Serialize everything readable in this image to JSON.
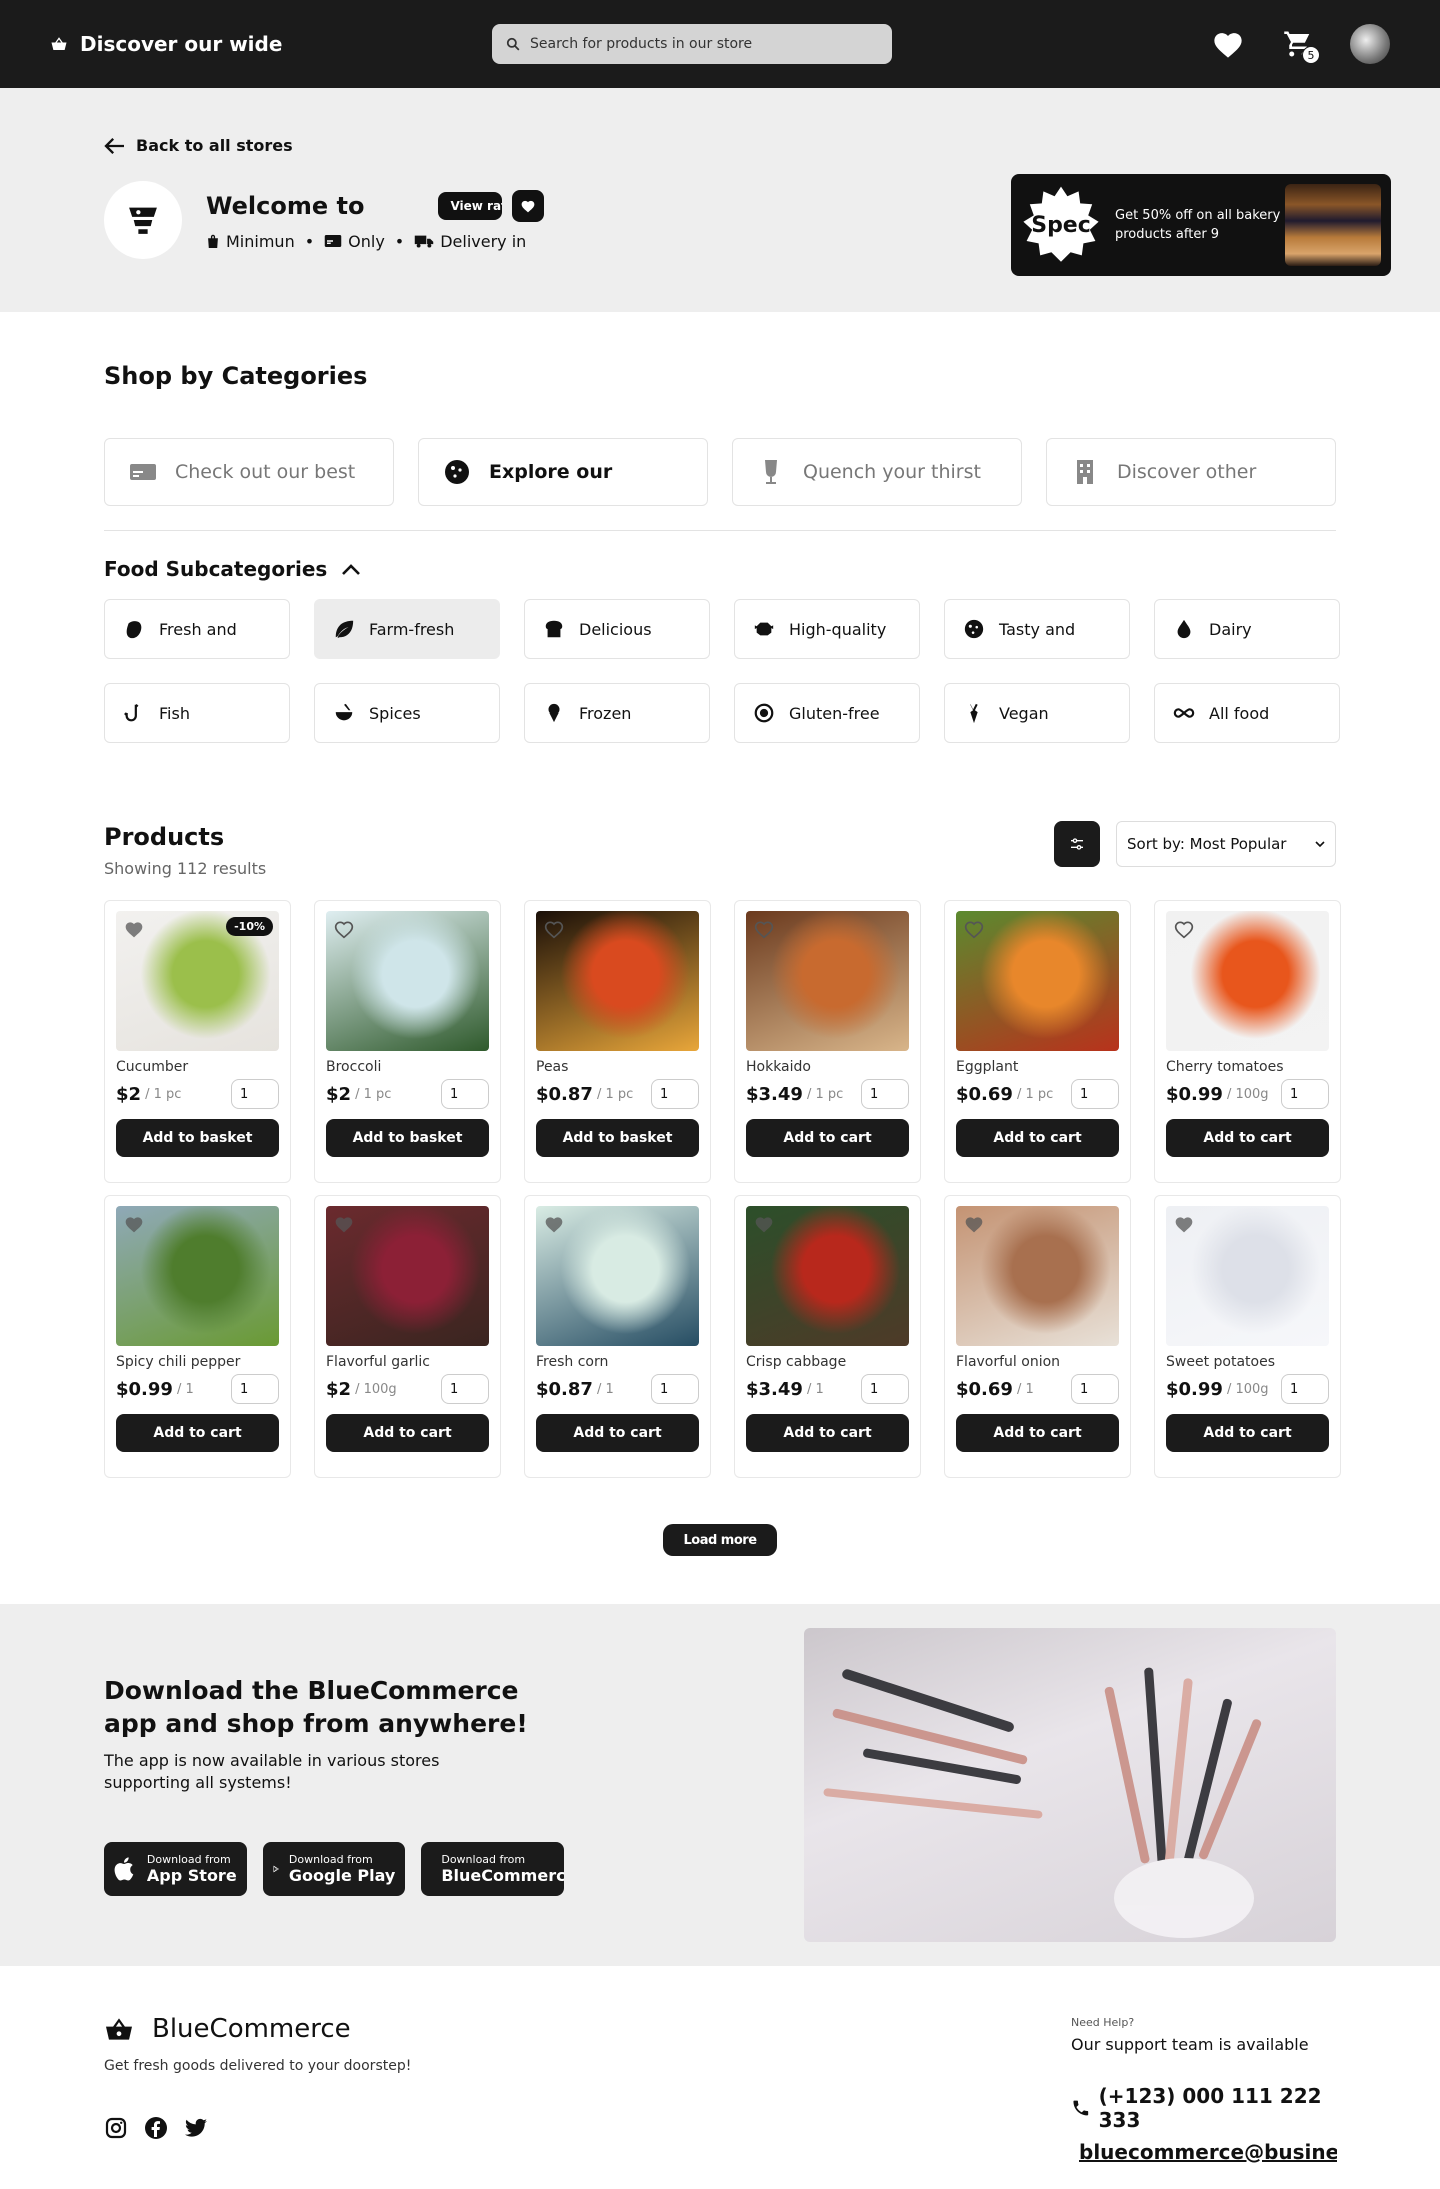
{
  "header": {
    "brand": "Discover our wide",
    "search_placeholder": "Search for products in our store",
    "cart_count": "5"
  },
  "store": {
    "back_label": "Back to all stores",
    "welcome": "Welcome to",
    "view_ratings": "View ratings",
    "meta": {
      "minimum": "Minimun",
      "only": "Only",
      "delivery": "Delivery in"
    },
    "promo": {
      "badge": "Spec",
      "text": "Get 50% off on all bakery products after 9"
    }
  },
  "categories": {
    "title": "Shop by Categories",
    "items": [
      {
        "label": "Check out our best",
        "icon": "card-icon"
      },
      {
        "label": "Explore our",
        "icon": "cookie-icon"
      },
      {
        "label": "Quench your thirst",
        "icon": "drink-icon"
      },
      {
        "label": "Discover other",
        "icon": "building-icon"
      }
    ]
  },
  "subcategories": {
    "title": "Food Subcategories",
    "items": [
      {
        "label": "Fresh and",
        "icon": "apple-icon"
      },
      {
        "label": "Farm-fresh",
        "icon": "leaf-icon"
      },
      {
        "label": "Delicious",
        "icon": "bread-icon"
      },
      {
        "label": "High-quality",
        "icon": "meat-icon"
      },
      {
        "label": "Tasty and",
        "icon": "cookie-icon"
      },
      {
        "label": "Dairy",
        "icon": "drop-icon"
      },
      {
        "label": "Fish",
        "icon": "fishhook-icon"
      },
      {
        "label": "Spices",
        "icon": "mortar-icon"
      },
      {
        "label": "Frozen",
        "icon": "icecream-icon"
      },
      {
        "label": "Gluten-free",
        "icon": "no-wheat-icon"
      },
      {
        "label": "Vegan",
        "icon": "carrot-icon"
      },
      {
        "label": "All food",
        "icon": "infinity-icon"
      }
    ]
  },
  "products": {
    "title": "Products",
    "count": "Showing 112 results",
    "sort_label": "Sort by: Most Popular",
    "load_more": "Load more",
    "items": [
      {
        "name": "Cucumber",
        "price": "$2",
        "unit": "/ 1 pc",
        "qty": "1",
        "button": "Add to basket",
        "badge": "-10%",
        "fav": true,
        "colors": [
          "#f2f1ef",
          "#9bbf4b",
          "#e6e3de"
        ]
      },
      {
        "name": "Broccoli",
        "price": "$2",
        "unit": "/ 1 pc",
        "qty": "1",
        "button": "Add to basket",
        "fav": false,
        "colors": [
          "#dfeef1",
          "#cfe5e9",
          "#2f5a2c"
        ]
      },
      {
        "name": "Peas",
        "price": "$0.87",
        "unit": "/ 1 pc",
        "qty": "1",
        "button": "Add to basket",
        "fav": false,
        "colors": [
          "#1a0f08",
          "#d94a1f",
          "#e8a63a"
        ]
      },
      {
        "name": "Hokkaido",
        "price": "$3.49",
        "unit": "/ 1 pc",
        "qty": "1",
        "button": "Add to cart",
        "fav": false,
        "colors": [
          "#6b3a1e",
          "#c86a2f",
          "#d8b58a"
        ]
      },
      {
        "name": "Eggplant",
        "price": "$0.69",
        "unit": "/ 1 pc",
        "qty": "1",
        "button": "Add to cart",
        "fav": false,
        "colors": [
          "#5b8a2f",
          "#e8872b",
          "#b8321c"
        ]
      },
      {
        "name": "Cherry tomatoes",
        "price": "$0.99",
        "unit": "/ 100g",
        "qty": "1",
        "button": "Add to cart",
        "fav": false,
        "colors": [
          "#f1f1f1",
          "#e8561c",
          "#f3f3f3"
        ]
      },
      {
        "name": "Spicy chili pepper",
        "price": "$0.99",
        "unit": "/ 1",
        "qty": "1",
        "button": "Add to cart",
        "fav": true,
        "colors": [
          "#8fa9b8",
          "#4f7d2d",
          "#6a9a33"
        ]
      },
      {
        "name": "Flavorful garlic",
        "price": "$2",
        "unit": "/ 100g",
        "qty": "1",
        "button": "Add to cart",
        "fav": true,
        "colors": [
          "#6b2a2e",
          "#8c2036",
          "#3a2520"
        ]
      },
      {
        "name": "Fresh corn",
        "price": "$0.87",
        "unit": "/ 1",
        "qty": "1",
        "button": "Add to cart",
        "fav": true,
        "colors": [
          "#d9ece4",
          "#d8ebe3",
          "#264d63"
        ]
      },
      {
        "name": "Crisp cabbage",
        "price": "$3.49",
        "unit": "/ 1",
        "qty": "1",
        "button": "Add to cart",
        "fav": true,
        "colors": [
          "#2c4f2a",
          "#b8281c",
          "#4e3a28"
        ]
      },
      {
        "name": "Flavorful onion",
        "price": "$0.69",
        "unit": "/ 1",
        "qty": "1",
        "button": "Add to cart",
        "fav": true,
        "colors": [
          "#c49373",
          "#a8704f",
          "#e8e1d8"
        ]
      },
      {
        "name": "Sweet potatoes",
        "price": "$0.99",
        "unit": "/ 100g",
        "qty": "1",
        "button": "Add to cart",
        "fav": true,
        "colors": [
          "#eef0f4",
          "#dde0e8",
          "#f6f7fa"
        ]
      }
    ]
  },
  "app": {
    "title": "Download the BlueCommerce app and shop from anywhere!",
    "text": "The app is now available in various stores supporting all systems!",
    "buttons": [
      {
        "small": "Download from",
        "large": "App Store",
        "icon": "apple-icon"
      },
      {
        "small": "Download from",
        "large": "Google Play",
        "icon": "play-icon"
      },
      {
        "small": "Download from",
        "large": "BlueCommerce",
        "icon": "bluecommerce-icon"
      }
    ]
  },
  "footer": {
    "brand": "BlueCommerce",
    "tagline": "Get fresh goods delivered to your doorstep!",
    "help_small": "Need Help?",
    "help_text": "Our support team is available",
    "phone": "(+123) 000 111 222 333",
    "email": "bluecommerce@business.com",
    "socials": [
      "instagram-icon",
      "facebook-icon",
      "twitter-icon"
    ]
  }
}
